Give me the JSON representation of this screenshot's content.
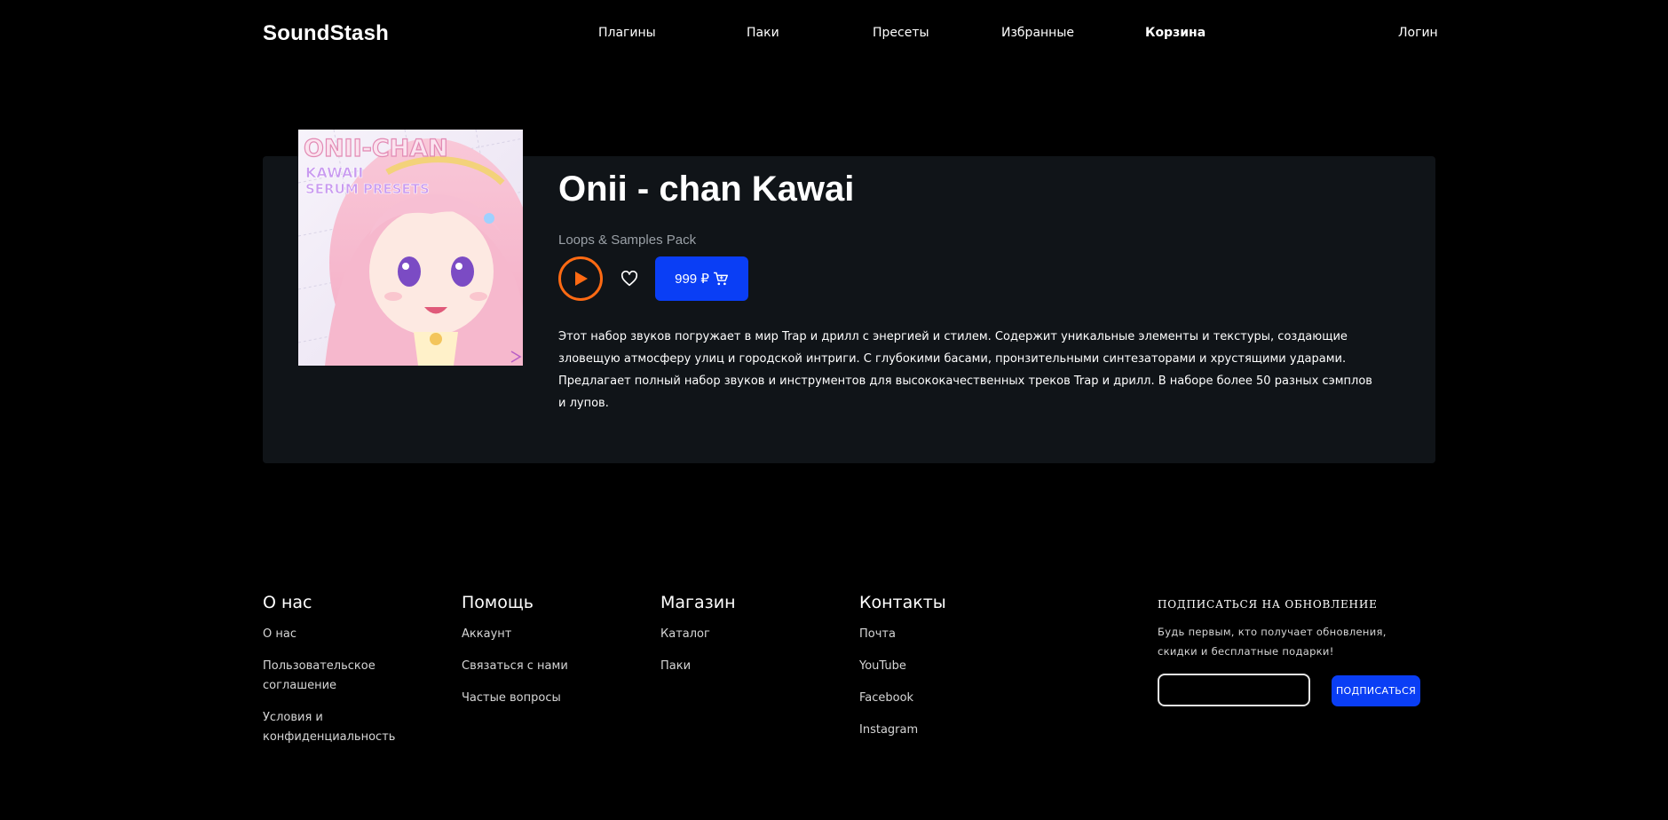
{
  "header": {
    "logo": "SoundStash",
    "nav": [
      {
        "label": "Плагины"
      },
      {
        "label": "Паки"
      },
      {
        "label": "Пресеты"
      },
      {
        "label": "Избранные"
      },
      {
        "label": "Корзина"
      }
    ],
    "login": "Логин"
  },
  "product": {
    "cover_text": {
      "line1": "ONII-CHAN",
      "line2": "KAWAII",
      "line3": "SERUM PRESETS"
    },
    "title": "Onii - chan Kawai",
    "subtitle": "Loops & Samples Pack",
    "price": "999 ₽",
    "description": "Этот набор звуков погружает в мир Trap и дрилл с энергией и стилем. Содержит уникальные элементы и текстуры, создающие зловещую атмосферу улиц и городской интриги. С глубокими басами, пронзительными синтезаторами и хрустящими ударами. Предлагает полный набор звуков и инструментов для высококачественных треков Trap и дрилл. В наборе более 50 разных сэмплов и лупов.",
    "icons": {
      "play": "play-icon",
      "favorite": "heart-icon",
      "cart": "cart-icon"
    },
    "colors": {
      "accent_orange": "#ff6a13",
      "accent_blue": "#0a3ef5",
      "panel": "#101418"
    }
  },
  "footer": {
    "columns": [
      {
        "title": "О нас",
        "links": [
          "О нас",
          "Пользовательское соглашение",
          "Условия и конфиденциальность"
        ]
      },
      {
        "title": "Помощь",
        "links": [
          "Аккаунт",
          "Связаться с нами",
          "Частые вопросы"
        ]
      },
      {
        "title": "Магазин",
        "links": [
          "Каталог",
          "Паки"
        ]
      },
      {
        "title": "Контакты",
        "links": [
          "Почта",
          "YouTube",
          "Facebook",
          "Instagram"
        ]
      }
    ],
    "subscribe": {
      "title": "ПОДПИСАТЬСЯ НА ОБНОВЛЕНИЕ",
      "text": "Будь первым, кто получает обновления, скидки и бесплатные подарки!",
      "email_value": "",
      "button": "ПОДПИСАТЬСЯ"
    }
  }
}
